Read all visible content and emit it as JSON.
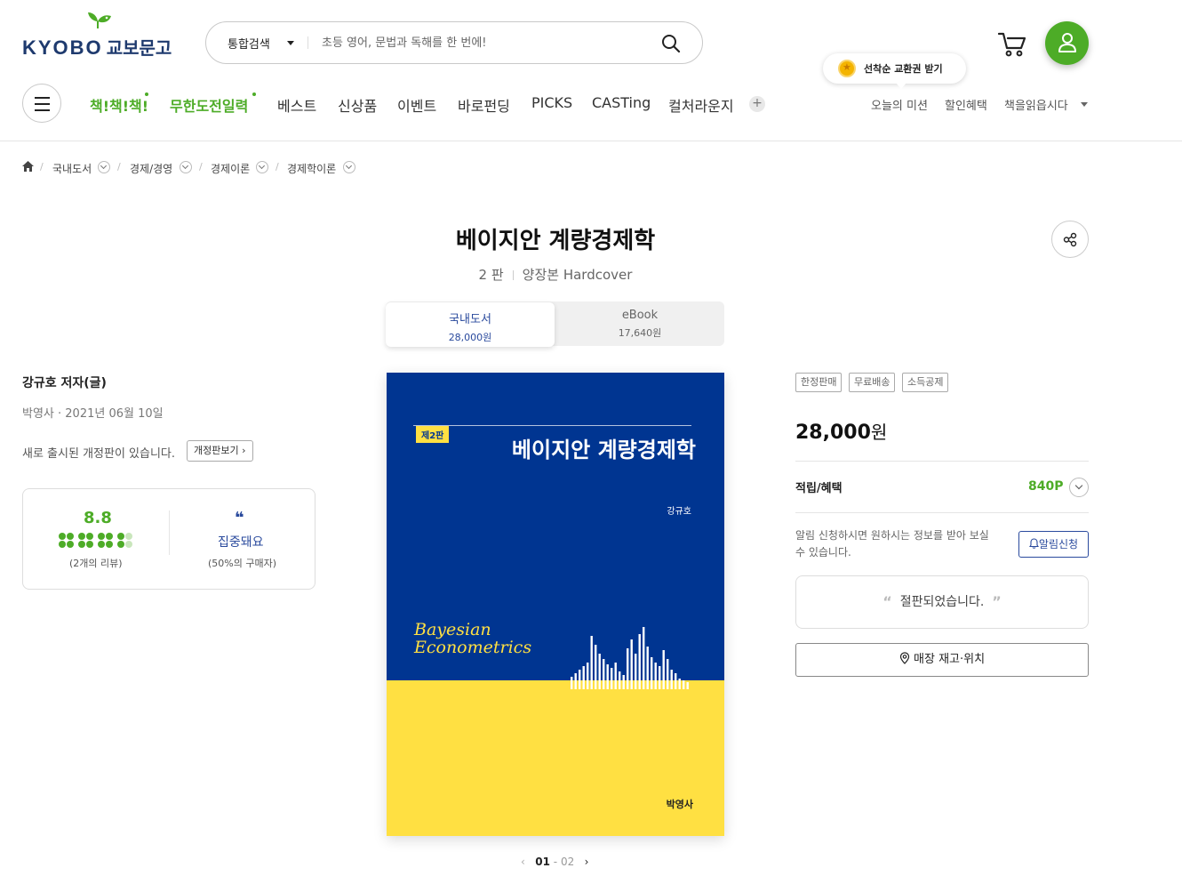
{
  "header": {
    "logo_text": "KYOBO",
    "logo_kr": "교보문고",
    "search": {
      "scope": "통합검색",
      "placeholder": "초등 영어, 문법과 독해를 한 번에!"
    },
    "promo_bubble": "선착순 교환권 받기",
    "gnb": [
      {
        "label": "책!책!책!",
        "highlight": true
      },
      {
        "label": "무한도전일력",
        "highlight": true
      },
      {
        "label": "베스트",
        "highlight": false
      },
      {
        "label": "신상품",
        "highlight": false
      },
      {
        "label": "이벤트",
        "highlight": false
      },
      {
        "label": "바로펀딩",
        "highlight": false
      },
      {
        "label": "PICKS",
        "highlight": false
      },
      {
        "label": "CASTing",
        "highlight": false
      },
      {
        "label": "컬처라운지",
        "highlight": false
      }
    ],
    "more_label": "+",
    "util": [
      "오늘의 미션",
      "할인혜택",
      "책을읽읍시다"
    ]
  },
  "breadcrumb": [
    "국내도서",
    "경제/경영",
    "경제이론",
    "경제학이론"
  ],
  "product": {
    "title": "베이지안 계량경제학",
    "edition": "2 판",
    "binding": "양장본 Hardcover",
    "formats": [
      {
        "name": "국내도서",
        "price": "28,000원",
        "active": true
      },
      {
        "name": "eBook",
        "price": "17,640원",
        "active": false
      }
    ],
    "author": "강규호 저자(글)",
    "publisher_date": "박영사 · 2021년 06월 10일",
    "revision_note": "새로 출시된 개정판이 있습니다.",
    "revision_button": "개정판보기 ›",
    "review": {
      "score": "8.8",
      "score_fraction": 0.88,
      "count": "(2개의 리뷰)",
      "quote_mark": "❝",
      "keyword": "집중돼요",
      "percent": "(50%의 구매자)"
    },
    "cover": {
      "edition_tag": "제2판",
      "title": "베이지안 계량경제학",
      "author": "강규호",
      "english_line1": "Bayesian",
      "english_line2": "Econometrics",
      "publisher": "박영사"
    },
    "pager": {
      "current": "01",
      "total": "02",
      "sep": " - "
    },
    "badges": [
      "한정판매",
      "무료배송",
      "소득공제"
    ],
    "price_number": "28,000",
    "price_unit": "원",
    "reward_label": "적립/혜택",
    "reward_value": "840P",
    "alarm_text": "알림 신청하시면 원하시는 정보를 받아 보실 수 있습니다.",
    "alarm_button": "알림신청",
    "soldout_text": "절판되었습니다.",
    "store_button": "매장 재고·위치"
  },
  "colors": {
    "brand_green": "#4dac27",
    "brand_navy": "#2a4a9d",
    "cover_blue": "#003591",
    "cover_yellow": "#ffe042"
  }
}
